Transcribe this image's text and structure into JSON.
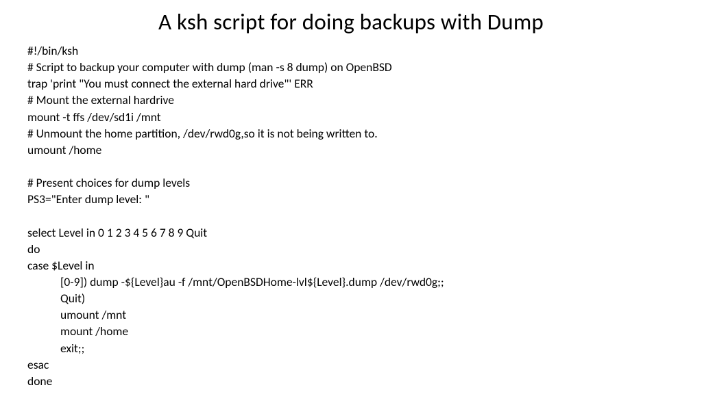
{
  "title": "A ksh script for doing backups with Dump",
  "lines": {
    "l0": "#!/bin/ksh",
    "l1": "# Script to backup your computer with dump (man -s 8 dump) on OpenBSD",
    "l2": "trap 'print \"You must connect the external hard drive\"' ERR",
    "l3": "# Mount the external hardrive",
    "l4": "mount -t ffs /dev/sd1i /mnt",
    "l5": "# Unmount the home partition, /dev/rwd0g,so it is not being written to.",
    "l6": "umount /home",
    "l7": "",
    "l8": "# Present choices for dump levels",
    "l9": "PS3=\"Enter dump level: \"",
    "l10": "",
    "l11": "select Level in 0 1 2 3 4 5 6 7 8 9 Quit",
    "l12": "do",
    "l13": "case $Level in",
    "l14": "[0-9]) dump -${Level}au -f /mnt/OpenBSDHome-lvl${Level}.dump /dev/rwd0g;;",
    "l15": "Quit)",
    "l16": "umount /mnt",
    "l17": "mount /home",
    "l18": "exit;;",
    "l19": "esac",
    "l20": "done"
  }
}
